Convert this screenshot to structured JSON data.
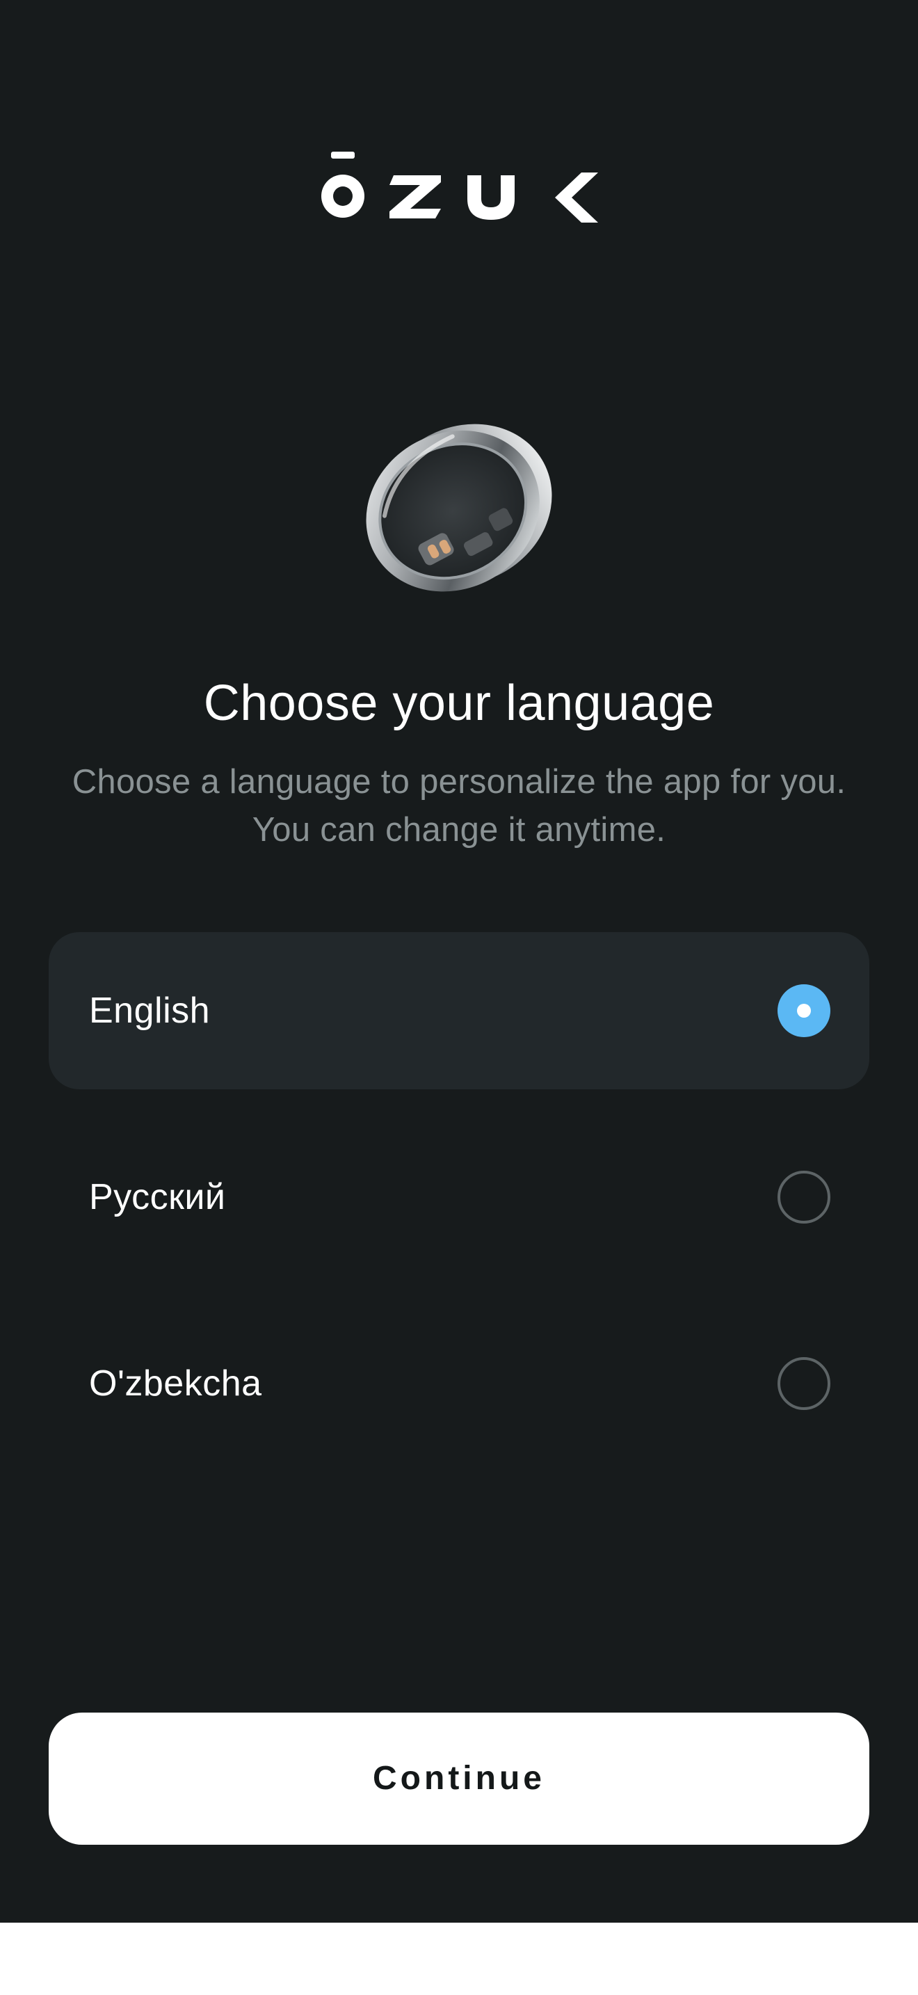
{
  "brand": {
    "logo_text": "OZUK"
  },
  "hero": {
    "image": "smart-ring-image"
  },
  "header": {
    "title": "Choose your language",
    "subtitle": "Choose a language to personalize the app for you. You can change it anytime."
  },
  "languages": {
    "items": [
      {
        "label": "English",
        "selected": true
      },
      {
        "label": "Русский",
        "selected": false
      },
      {
        "label": "O'zbekcha",
        "selected": false
      }
    ]
  },
  "footer": {
    "continue_label": "Continue"
  },
  "colors": {
    "background": "#171b1c",
    "selected_row": "#22282b",
    "accent": "#5bb8f4",
    "subtitle": "#8a9294"
  }
}
